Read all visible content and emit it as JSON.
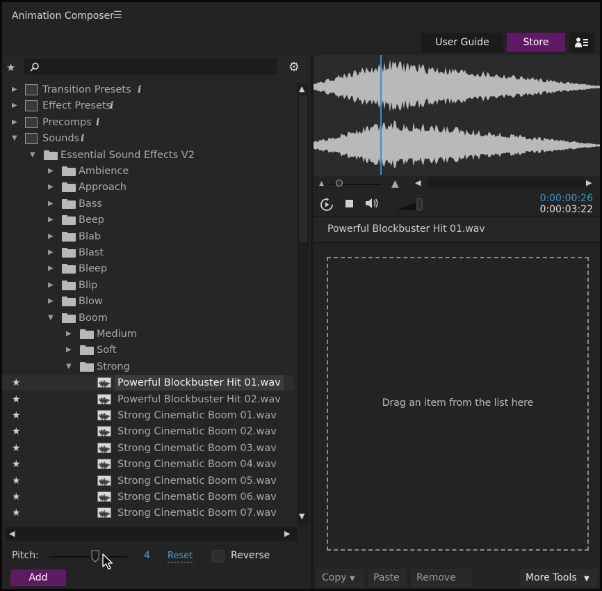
{
  "app": {
    "title": "Animation Composer"
  },
  "header": {
    "user_guide": "User Guide",
    "store": "Store",
    "accent": "#5e1a63"
  },
  "search": {
    "placeholder": ""
  },
  "tree": {
    "root": [
      {
        "label": "Transition Presets",
        "icon": "transition-icon"
      },
      {
        "label": "Effect Presets",
        "icon": "effect-icon"
      },
      {
        "label": "Precomps",
        "icon": "precomp-icon"
      },
      {
        "label": "Sounds",
        "icon": "sound-icon"
      }
    ],
    "pack": "Essential Sound Effects V2",
    "folders": [
      "Ambience",
      "Approach",
      "Bass",
      "Beep",
      "Blab",
      "Blast",
      "Bleep",
      "Blip",
      "Blow",
      "Boom"
    ],
    "boom_children": [
      "Medium",
      "Soft",
      "Strong"
    ],
    "files": [
      "Powerful Blockbuster Hit 01.wav",
      "Powerful Blockbuster Hit 02.wav",
      "Strong Cinematic Boom 01.wav",
      "Strong Cinematic Boom 02.wav",
      "Strong Cinematic Boom 03.wav",
      "Strong Cinematic Boom 04.wav",
      "Strong Cinematic Boom 05.wav",
      "Strong Cinematic Boom 06.wav",
      "Strong Cinematic Boom 07.wav"
    ],
    "selected_index": 0,
    "info_glyph": "i"
  },
  "controls": {
    "pitch_label": "Pitch:",
    "pitch_value": "4",
    "reset": "Reset",
    "reverse": "Reverse",
    "add": "Add"
  },
  "player": {
    "current_time": "0:00:00:26",
    "total_time": "0:00:03:22",
    "playhead_fraction": 0.22,
    "file_name": "Powerful Blockbuster Hit 01.wav"
  },
  "drop": {
    "text": "Drag an item from the list here"
  },
  "bottom": {
    "copy": "Copy",
    "paste": "Paste",
    "remove": "Remove",
    "more_tools": "More Tools"
  }
}
